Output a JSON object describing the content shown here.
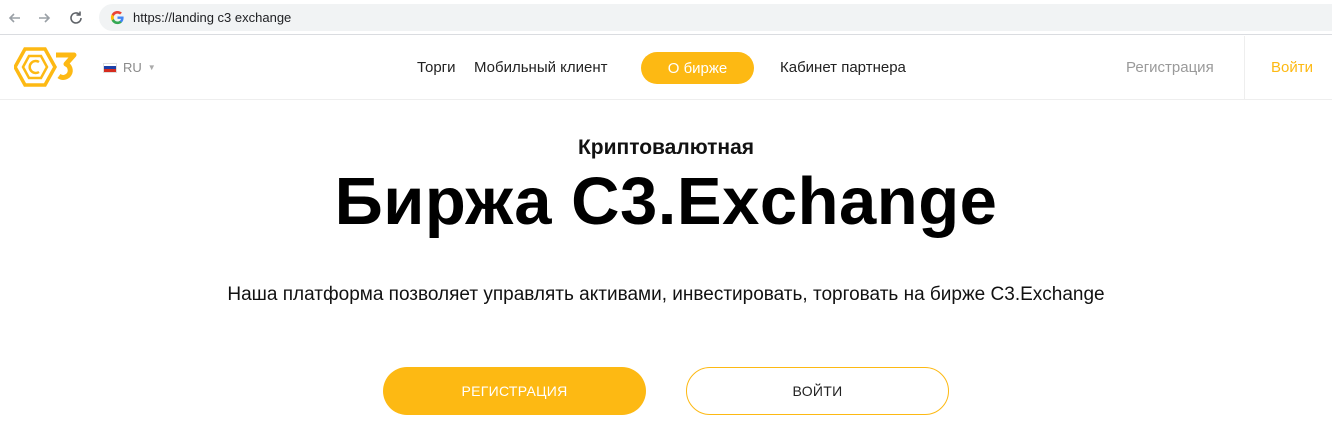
{
  "browser": {
    "url": "https://landing c3 exchange"
  },
  "header": {
    "language": "RU",
    "nav": {
      "trade": "Торги",
      "mobile_client": "Мобильный клиент",
      "about": "О бирже",
      "partner_cabinet": "Кабинет партнера"
    },
    "register": "Регистрация",
    "login": "Войти"
  },
  "hero": {
    "subtitle": "Криптовалютная",
    "title": "Биржа C3.Exchange",
    "description": "Наша платформа позволяет управлять активами, инвестировать, торговать на бирже C3.Exchange",
    "register_button": "РЕГИСТРАЦИЯ",
    "login_button": "ВОЙТИ"
  },
  "colors": {
    "accent": "#fdb913",
    "text": "#111111",
    "muted": "#9a9a9a"
  },
  "icons": {
    "back": "arrow-left-icon",
    "forward": "arrow-right-icon",
    "reload": "reload-icon",
    "site": "google-g-icon",
    "logo": "c3-logo-icon",
    "flag": "russia-flag-icon"
  }
}
